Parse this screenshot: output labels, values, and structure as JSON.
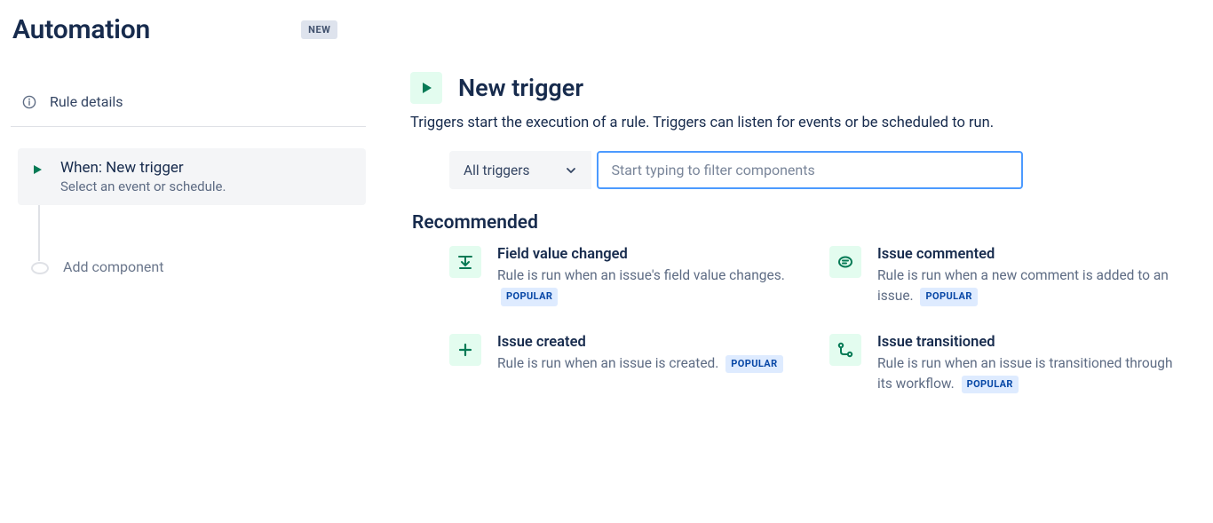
{
  "header": {
    "title": "Automation",
    "badge": "NEW"
  },
  "sidebar": {
    "rule_details_label": "Rule details",
    "step": {
      "title": "When: New trigger",
      "subtitle": "Select an event or schedule."
    },
    "add_component_label": "Add component"
  },
  "main": {
    "title": "New trigger",
    "description": "Triggers start the execution of a rule. Triggers can listen for events or be scheduled to run.",
    "category_selected": "All triggers",
    "filter_placeholder": "Start typing to filter components",
    "recommended_label": "Recommended",
    "popular_badge": "POPULAR",
    "recommended": [
      {
        "icon": "field-change-icon",
        "title": "Field value changed",
        "desc": "Rule is run when an issue's field value changes.",
        "popular": true
      },
      {
        "icon": "comment-icon",
        "title": "Issue commented",
        "desc": "Rule is run when a new comment is added to an issue.",
        "popular": true
      },
      {
        "icon": "plus-icon",
        "title": "Issue created",
        "desc": "Rule is run when an issue is created.",
        "popular": true
      },
      {
        "icon": "transition-icon",
        "title": "Issue transitioned",
        "desc": "Rule is run when an issue is transitioned through its workflow.",
        "popular": true
      }
    ]
  }
}
